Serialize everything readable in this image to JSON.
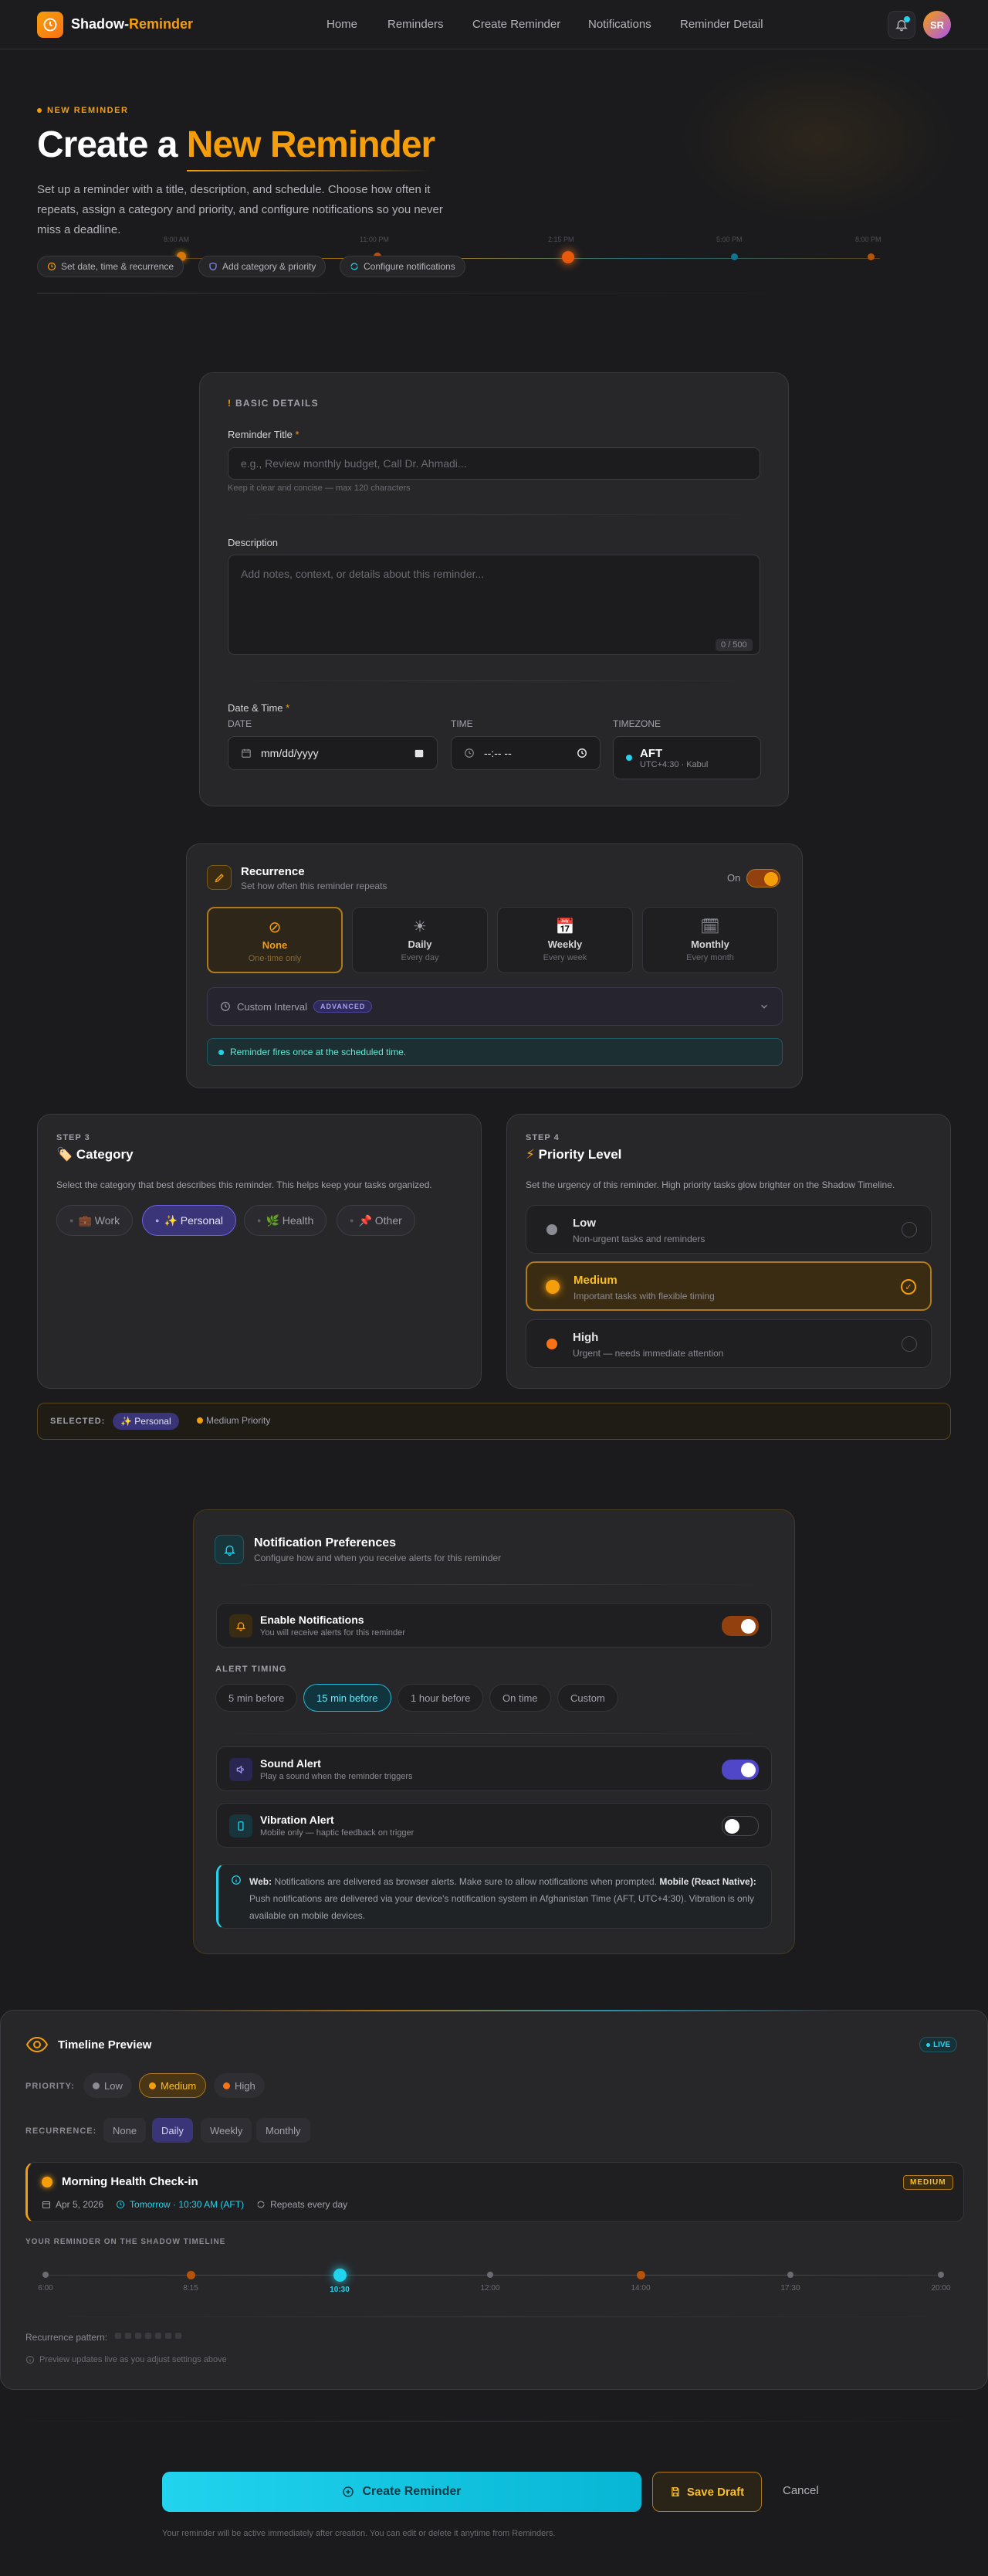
{
  "nav": {
    "brand_a": "Shadow-",
    "brand_b": "Reminder",
    "links": [
      "Home",
      "Reminders",
      "Create Reminder",
      "Notifications",
      "Reminder Detail"
    ],
    "avatar": "SR"
  },
  "hero": {
    "eyebrow": "NEW REMINDER",
    "title_a": "Create a ",
    "title_b": "New Reminder",
    "description": "Set up a reminder with a title, description, and schedule. Choose how often it repeats, assign a category and priority, and configure notifications so you never miss a deadline.",
    "chips": [
      "Set date, time & recurrence",
      "Add category & priority",
      "Configure notifications"
    ],
    "timeline_labels": [
      "8:00 AM",
      "11:00 PM",
      "2:15 PM",
      "5:00 PM",
      "8:00 PM"
    ]
  },
  "basic": {
    "section": "BASIC DETAILS",
    "title_label": "Reminder Title",
    "title_placeholder": "e.g., Review monthly budget, Call Dr. Ahmadi...",
    "title_hint": "Keep it clear and concise — max 120 characters",
    "desc_label": "Description",
    "desc_placeholder": "Add notes, context, or details about this reminder...",
    "desc_counter": "0 / 500",
    "datetime_label": "Date & Time",
    "date_label": "DATE",
    "date_value": "mm/dd/yyyy",
    "time_label": "TIME",
    "time_value": "--:-- --",
    "tz_label": "TIMEZONE",
    "tz_code": "AFT",
    "tz_detail": "UTC+4:30 · Kabul"
  },
  "recurrence": {
    "title": "Recurrence",
    "subtitle": "Set how often this reminder repeats",
    "toggle_label": "On",
    "options": [
      {
        "label": "None",
        "sub": "One-time only",
        "icon": "⊘"
      },
      {
        "label": "Daily",
        "sub": "Every day",
        "icon": "☀"
      },
      {
        "label": "Weekly",
        "sub": "Every week",
        "icon": "📅"
      },
      {
        "label": "Monthly",
        "sub": "Every month",
        "icon": "🗓"
      }
    ],
    "custom_label": "Custom Interval",
    "custom_badge": "ADVANCED",
    "info": "Reminder fires once at the scheduled time."
  },
  "category": {
    "step": "STEP 3",
    "title": "Category",
    "desc": "Select the category that best describes this reminder. This helps keep your tasks organized.",
    "items": [
      "💼 Work",
      "✨ Personal",
      "🌿 Health",
      "📌 Other"
    ]
  },
  "priority": {
    "step": "STEP 4",
    "title": "Priority Level",
    "desc": "Set the urgency of this reminder. High priority tasks glow brighter on the Shadow Timeline.",
    "items": [
      {
        "label": "Low",
        "sub": "Non-urgent tasks and reminders"
      },
      {
        "label": "Medium",
        "sub": "Important tasks with flexible timing"
      },
      {
        "label": "High",
        "sub": "Urgent — needs immediate attention"
      }
    ]
  },
  "selected": {
    "label": "SELECTED:",
    "category": "✨ Personal",
    "priority": "Medium Priority"
  },
  "notifications": {
    "title": "Notification Preferences",
    "subtitle": "Configure how and when you receive alerts for this reminder",
    "enable_title": "Enable Notifications",
    "enable_sub": "You will receive alerts for this reminder",
    "timing_label": "ALERT TIMING",
    "timings": [
      "5 min before",
      "15 min before",
      "1 hour before",
      "On time",
      "Custom"
    ],
    "sound_title": "Sound Alert",
    "sound_sub": "Play a sound when the reminder triggers",
    "vibe_title": "Vibration Alert",
    "vibe_sub": "Mobile only — haptic feedback on trigger",
    "note_web_b": "Web:",
    "note_web": " Notifications are delivered as browser alerts. Make sure to allow notifications when prompted. ",
    "note_native_b": "Mobile (React Native):",
    "note_native": " Push notifications are delivered via your device's notification system in Afghanistan Time (AFT, UTC+4:30). Vibration is only available on mobile devices."
  },
  "preview": {
    "title": "Timeline Preview",
    "live": "LIVE",
    "priority_label": "PRIORITY:",
    "priorities": [
      "Low",
      "Medium",
      "High"
    ],
    "recurrence_label": "RECURRENCE:",
    "recurrences": [
      "None",
      "Daily",
      "Weekly",
      "Monthly"
    ],
    "reminder_title": "Morning Health Check-in",
    "reminder_badge": "MEDIUM",
    "reminder_date": "Apr 5, 2026",
    "reminder_when": "Tomorrow · 10:30 AM (AFT)",
    "reminder_repeat": "Repeats every day",
    "shadow_label": "YOUR REMINDER ON THE SHADOW TIMELINE",
    "ticks": [
      "6:00",
      "8:15",
      "10:30",
      "12:00",
      "14:00",
      "17:30",
      "20:00"
    ],
    "pattern_label": "Recurrence pattern:",
    "footer": "Preview updates live as you adjust settings above"
  },
  "actions": {
    "create": "Create Reminder",
    "draft": "Save Draft",
    "cancel": "Cancel",
    "note": "Your reminder will be active immediately after creation. You can edit or delete it anytime from Reminders."
  },
  "colors": {
    "accent": "#f59e0b",
    "cyan": "#22d3ee",
    "purple": "#6d60e0"
  }
}
